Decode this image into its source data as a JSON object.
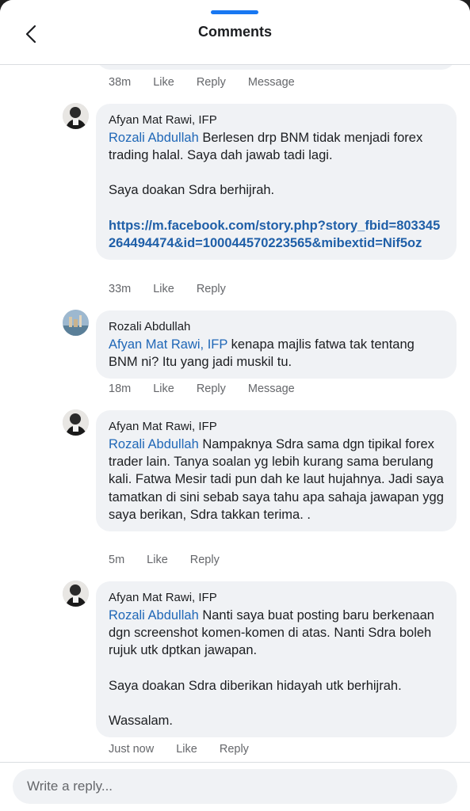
{
  "header": {
    "title": "Comments"
  },
  "prev_actions": {
    "time": "38m",
    "like": "Like",
    "reply": "Reply",
    "message": "Message"
  },
  "comments": [
    {
      "author": "Afyan Mat Rawi, IFP",
      "mention": "Rozali Abdullah",
      "p1": " Berlesen drp BNM tidak menjadi forex trading halal. Saya dah jawab tadi lagi.",
      "p2": "Saya doakan Sdra berhijrah.",
      "link": "https://m.facebook.com/story.php?story_fbid=803345264494474&id=100044570223565&mibextid=Nif5oz",
      "actions": {
        "time": "33m",
        "like": "Like",
        "reply": "Reply"
      }
    },
    {
      "author": "Rozali Abdullah",
      "mention": "Afyan Mat Rawi, IFP",
      "p1": " kenapa majlis fatwa tak tentang BNM ni? Itu yang jadi muskil tu.",
      "actions": {
        "time": "18m",
        "like": "Like",
        "reply": "Reply",
        "message": "Message"
      }
    },
    {
      "author": "Afyan Mat Rawi, IFP",
      "mention": "Rozali Abdullah",
      "p1": " Nampaknya Sdra sama dgn tipikal forex trader lain. Tanya soalan yg lebih kurang sama berulang kali. Fatwa Mesir tadi pun dah ke laut hujahnya. Jadi saya tamatkan di sini sebab saya tahu apa sahaja jawapan ygg saya berikan, Sdra takkan terima. .",
      "actions": {
        "time": "5m",
        "like": "Like",
        "reply": "Reply"
      }
    },
    {
      "author": "Afyan Mat Rawi, IFP",
      "mention": "Rozali Abdullah",
      "p1": " Nanti saya buat posting baru berkenaan dgn screenshot komen-komen di atas. Nanti Sdra boleh rujuk utk dptkan jawapan.",
      "p2": "Saya doakan Sdra diberikan hidayah utk berhijrah.",
      "p3": "Wassalam.",
      "actions": {
        "time": "Just now",
        "like": "Like",
        "reply": "Reply"
      }
    }
  ],
  "reply_box": {
    "placeholder": "Write a reply..."
  },
  "icons": {
    "back": "chevron-left-icon"
  },
  "colors": {
    "accent": "#1877f2",
    "mention": "#1f67b7",
    "bubble": "#f0f2f5",
    "meta": "#65676b"
  }
}
